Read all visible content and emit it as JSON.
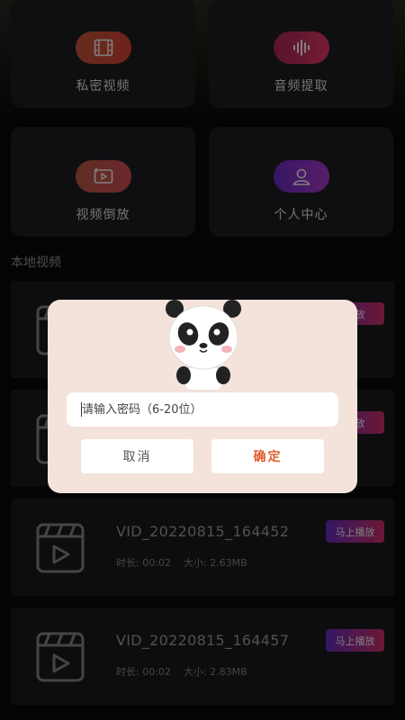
{
  "features": [
    {
      "label": "私密视频",
      "icon": "film-icon",
      "gradient": "g-red"
    },
    {
      "label": "音频提取",
      "icon": "waveform-icon",
      "gradient": "g-pink"
    },
    {
      "label": "视频倒放",
      "icon": "reverse-play-icon",
      "gradient": "g-orange"
    },
    {
      "label": "个人中心",
      "icon": "user-icon",
      "gradient": "g-purple"
    }
  ],
  "section_title": "本地视频",
  "videos": [
    {
      "name": "",
      "duration_label": "",
      "size_label": "",
      "play_label": "播放"
    },
    {
      "name": "",
      "duration_label": "",
      "size_label": "",
      "play_label": "播放"
    },
    {
      "name": "VID_20220815_164452",
      "duration_label": "时长:  00:02",
      "size_label": "大小:  2.63MB",
      "play_label": "马上播放"
    },
    {
      "name": "VID_20220815_164457",
      "duration_label": "时长:  00:02",
      "size_label": "大小:  2.83MB",
      "play_label": "马上播放"
    }
  ],
  "dialog": {
    "placeholder": "请输入密码（6-20位）",
    "cancel_label": "取消",
    "confirm_label": "确定"
  },
  "colors": {
    "confirm": "#e25a2a",
    "play_badge_start": "#6a2ec8",
    "play_badge_end": "#d8326a",
    "dialog_bg": "#f3e3da"
  }
}
